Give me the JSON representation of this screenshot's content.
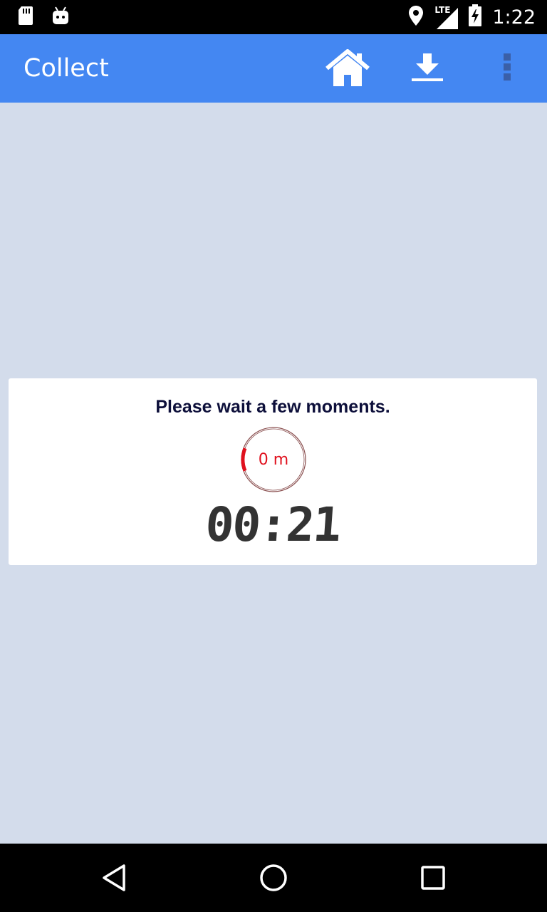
{
  "status_bar": {
    "time": "1:22",
    "network": "LTE",
    "icons": [
      "sd-card-icon",
      "android-icon",
      "location-icon",
      "signal-icon",
      "battery-charging-icon"
    ]
  },
  "app_bar": {
    "title": "Collect",
    "actions": [
      "home-icon",
      "download-icon",
      "more-vert-icon"
    ],
    "color": "#4487f2"
  },
  "dialog": {
    "message": "Please wait a few moments.",
    "progress_label": "0 m",
    "progress_fraction": 0.12,
    "timer": "00:21",
    "accent_color": "#e0101d"
  },
  "nav_bar": {
    "buttons": [
      "back-icon",
      "home-circle-icon",
      "recents-icon"
    ]
  }
}
